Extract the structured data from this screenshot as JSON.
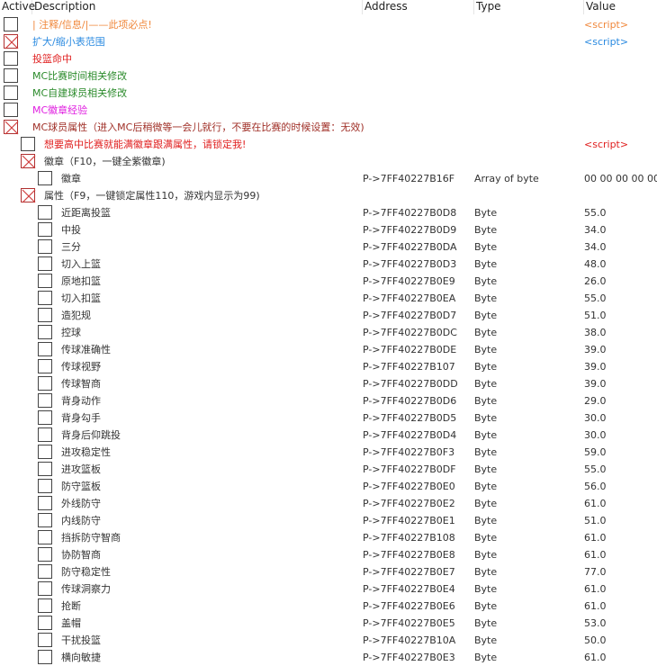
{
  "columns": {
    "active": "Active",
    "description": "Description",
    "address": "Address",
    "type": "Type",
    "value": "Value"
  },
  "rows": [
    {
      "level": 0,
      "checked": false,
      "desc": "| 注释/信息/|——此项必点!",
      "color": "#f0883c",
      "address": "",
      "type": "",
      "value": "<script>",
      "value_color": "#f0883c"
    },
    {
      "level": 0,
      "checked": true,
      "desc": "扩大/缩小表范围",
      "color": "#2a8ae0",
      "address": "",
      "type": "",
      "value": "<script>",
      "value_color": "#2a8ae0"
    },
    {
      "level": 0,
      "checked": false,
      "desc": "投篮命中",
      "color": "#e02020",
      "address": "",
      "type": "",
      "value": "",
      "value_color": "#333333"
    },
    {
      "level": 0,
      "checked": false,
      "desc": "MC比赛时间相关修改",
      "color": "#2a8a2a",
      "address": "",
      "type": "",
      "value": "",
      "value_color": "#333333"
    },
    {
      "level": 0,
      "checked": false,
      "desc": "MC自建球员相关修改",
      "color": "#2a8a2a",
      "address": "",
      "type": "",
      "value": "",
      "value_color": "#333333"
    },
    {
      "level": 0,
      "checked": false,
      "desc": "MC徽章经验",
      "color": "#e020e0",
      "address": "",
      "type": "",
      "value": "",
      "value_color": "#333333"
    },
    {
      "level": 0,
      "checked": true,
      "desc": "MC球员属性（进入MC后稍微等一会儿就行，不要在比赛的时候设置：无效)",
      "color": "#a03028",
      "address": "",
      "type": "",
      "value": "",
      "value_color": "#333333"
    },
    {
      "level": 1,
      "checked": false,
      "desc": "想要高中比赛就能满徽章跟满属性，请锁定我!",
      "color": "#e02020",
      "address": "",
      "type": "",
      "value": "<script>",
      "value_color": "#e02020"
    },
    {
      "level": 1,
      "checked": true,
      "desc": "徽章（F10，一键全紫徽章)",
      "color": "#333333",
      "address": "",
      "type": "",
      "value": "",
      "value_color": "#333333"
    },
    {
      "level": 2,
      "checked": false,
      "desc": "徽章",
      "color": "#333333",
      "address": "P->7FF40227B16F",
      "type": "Array of byte",
      "value": "00 00 00 00 00",
      "value_color": "#333333"
    },
    {
      "level": 1,
      "checked": true,
      "desc": "属性（F9，一键锁定属性110，游戏内显示为99)",
      "color": "#333333",
      "address": "",
      "type": "",
      "value": "",
      "value_color": "#333333"
    },
    {
      "level": 2,
      "checked": false,
      "desc": "近距离投篮",
      "color": "#333333",
      "address": "P->7FF40227B0D8",
      "type": "Byte",
      "value": "55.0",
      "value_color": "#333333"
    },
    {
      "level": 2,
      "checked": false,
      "desc": "中投",
      "color": "#333333",
      "address": "P->7FF40227B0D9",
      "type": "Byte",
      "value": "34.0",
      "value_color": "#333333"
    },
    {
      "level": 2,
      "checked": false,
      "desc": "三分",
      "color": "#333333",
      "address": "P->7FF40227B0DA",
      "type": "Byte",
      "value": "34.0",
      "value_color": "#333333"
    },
    {
      "level": 2,
      "checked": false,
      "desc": "切入上篮",
      "color": "#333333",
      "address": "P->7FF40227B0D3",
      "type": "Byte",
      "value": "48.0",
      "value_color": "#333333"
    },
    {
      "level": 2,
      "checked": false,
      "desc": "原地扣篮",
      "color": "#333333",
      "address": "P->7FF40227B0E9",
      "type": "Byte",
      "value": "26.0",
      "value_color": "#333333"
    },
    {
      "level": 2,
      "checked": false,
      "desc": "切入扣篮",
      "color": "#333333",
      "address": "P->7FF40227B0EA",
      "type": "Byte",
      "value": "55.0",
      "value_color": "#333333"
    },
    {
      "level": 2,
      "checked": false,
      "desc": "造犯规",
      "color": "#333333",
      "address": "P->7FF40227B0D7",
      "type": "Byte",
      "value": "51.0",
      "value_color": "#333333"
    },
    {
      "level": 2,
      "checked": false,
      "desc": "控球",
      "color": "#333333",
      "address": "P->7FF40227B0DC",
      "type": "Byte",
      "value": "38.0",
      "value_color": "#333333"
    },
    {
      "level": 2,
      "checked": false,
      "desc": "传球准确性",
      "color": "#333333",
      "address": "P->7FF40227B0DE",
      "type": "Byte",
      "value": "39.0",
      "value_color": "#333333"
    },
    {
      "level": 2,
      "checked": false,
      "desc": "传球视野",
      "color": "#333333",
      "address": "P->7FF40227B107",
      "type": "Byte",
      "value": "39.0",
      "value_color": "#333333"
    },
    {
      "level": 2,
      "checked": false,
      "desc": "传球智商",
      "color": "#333333",
      "address": "P->7FF40227B0DD",
      "type": "Byte",
      "value": "39.0",
      "value_color": "#333333"
    },
    {
      "level": 2,
      "checked": false,
      "desc": "背身动作",
      "color": "#333333",
      "address": "P->7FF40227B0D6",
      "type": "Byte",
      "value": "29.0",
      "value_color": "#333333"
    },
    {
      "level": 2,
      "checked": false,
      "desc": "背身勾手",
      "color": "#333333",
      "address": "P->7FF40227B0D5",
      "type": "Byte",
      "value": "30.0",
      "value_color": "#333333"
    },
    {
      "level": 2,
      "checked": false,
      "desc": "背身后仰跳投",
      "color": "#333333",
      "address": "P->7FF40227B0D4",
      "type": "Byte",
      "value": "30.0",
      "value_color": "#333333"
    },
    {
      "level": 2,
      "checked": false,
      "desc": "进攻稳定性",
      "color": "#333333",
      "address": "P->7FF40227B0F3",
      "type": "Byte",
      "value": "59.0",
      "value_color": "#333333"
    },
    {
      "level": 2,
      "checked": false,
      "desc": "进攻篮板",
      "color": "#333333",
      "address": "P->7FF40227B0DF",
      "type": "Byte",
      "value": "55.0",
      "value_color": "#333333"
    },
    {
      "level": 2,
      "checked": false,
      "desc": "防守篮板",
      "color": "#333333",
      "address": "P->7FF40227B0E0",
      "type": "Byte",
      "value": "56.0",
      "value_color": "#333333"
    },
    {
      "level": 2,
      "checked": false,
      "desc": "外线防守",
      "color": "#333333",
      "address": "P->7FF40227B0E2",
      "type": "Byte",
      "value": "61.0",
      "value_color": "#333333"
    },
    {
      "level": 2,
      "checked": false,
      "desc": "内线防守",
      "color": "#333333",
      "address": "P->7FF40227B0E1",
      "type": "Byte",
      "value": "51.0",
      "value_color": "#333333"
    },
    {
      "level": 2,
      "checked": false,
      "desc": "挡拆防守智商",
      "color": "#333333",
      "address": "P->7FF40227B108",
      "type": "Byte",
      "value": "61.0",
      "value_color": "#333333"
    },
    {
      "level": 2,
      "checked": false,
      "desc": "协防智商",
      "color": "#333333",
      "address": "P->7FF40227B0E8",
      "type": "Byte",
      "value": "61.0",
      "value_color": "#333333"
    },
    {
      "level": 2,
      "checked": false,
      "desc": "防守稳定性",
      "color": "#333333",
      "address": "P->7FF40227B0E7",
      "type": "Byte",
      "value": "77.0",
      "value_color": "#333333"
    },
    {
      "level": 2,
      "checked": false,
      "desc": "传球洞察力",
      "color": "#333333",
      "address": "P->7FF40227B0E4",
      "type": "Byte",
      "value": "61.0",
      "value_color": "#333333"
    },
    {
      "level": 2,
      "checked": false,
      "desc": "抢断",
      "color": "#333333",
      "address": "P->7FF40227B0E6",
      "type": "Byte",
      "value": "61.0",
      "value_color": "#333333"
    },
    {
      "level": 2,
      "checked": false,
      "desc": "盖帽",
      "color": "#333333",
      "address": "P->7FF40227B0E5",
      "type": "Byte",
      "value": "53.0",
      "value_color": "#333333"
    },
    {
      "level": 2,
      "checked": false,
      "desc": "干扰投篮",
      "color": "#333333",
      "address": "P->7FF40227B10A",
      "type": "Byte",
      "value": "50.0",
      "value_color": "#333333"
    },
    {
      "level": 2,
      "checked": false,
      "desc": "横向敏捷",
      "color": "#333333",
      "address": "P->7FF40227B0E3",
      "type": "Byte",
      "value": "61.0",
      "value_color": "#333333"
    }
  ]
}
